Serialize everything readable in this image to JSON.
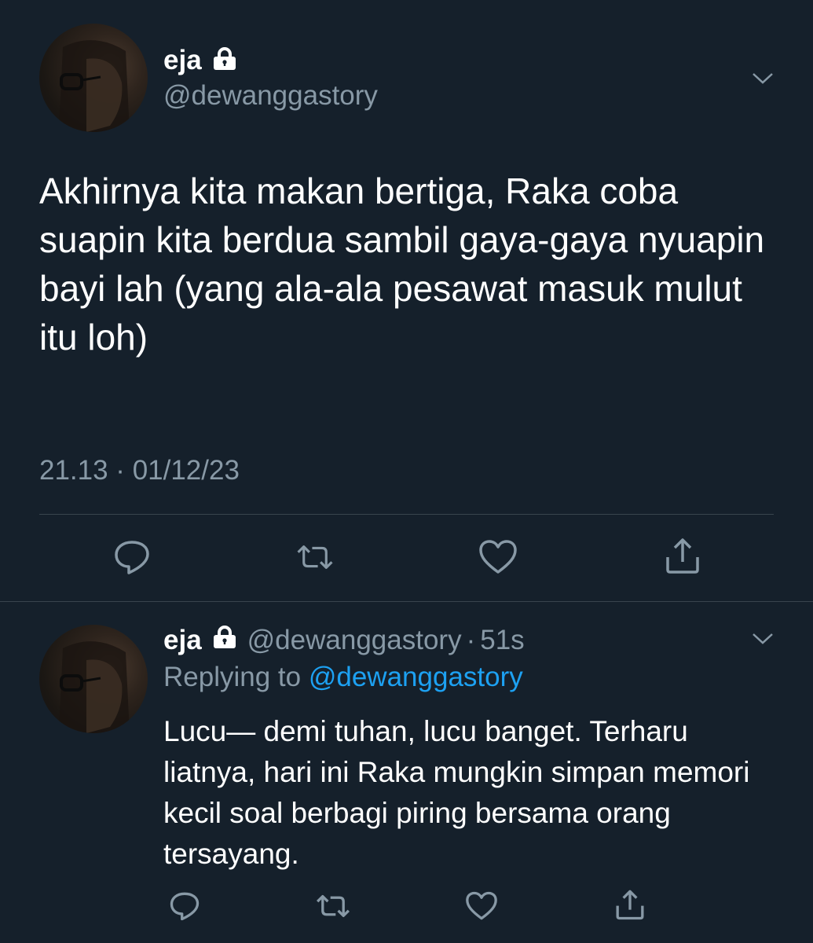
{
  "tweet": {
    "display_name": "eja",
    "handle": "@dewanggastory",
    "text": "Akhirnya kita makan bertiga, Raka coba suapin kita berdua sambil gaya-gaya nyuapin bayi lah (yang ala-ala pesawat masuk mulut itu loh)",
    "timestamp": "21.13 · 01/12/23",
    "icons": {
      "lock": "lock-icon",
      "more": "chevron-down-icon",
      "reply": "reply-bubble-icon",
      "retweet": "retweet-icon",
      "like": "heart-icon",
      "share": "share-icon"
    }
  },
  "reply": {
    "display_name": "eja",
    "handle": "@dewanggastory",
    "separator": "·",
    "age": "51s",
    "replying_prefix": "Replying to",
    "replying_to": "@dewanggastory",
    "text": "Lucu— demi tuhan, lucu banget. Terharu liatnya, hari ini Raka mungkin simpan memori kecil soal berbagi piring bersama orang tersayang."
  },
  "colors": {
    "background": "#15202b",
    "primary_text": "#ffffff",
    "secondary_text": "#8899a6",
    "accent": "#1da1f2",
    "divider": "#38444d"
  }
}
